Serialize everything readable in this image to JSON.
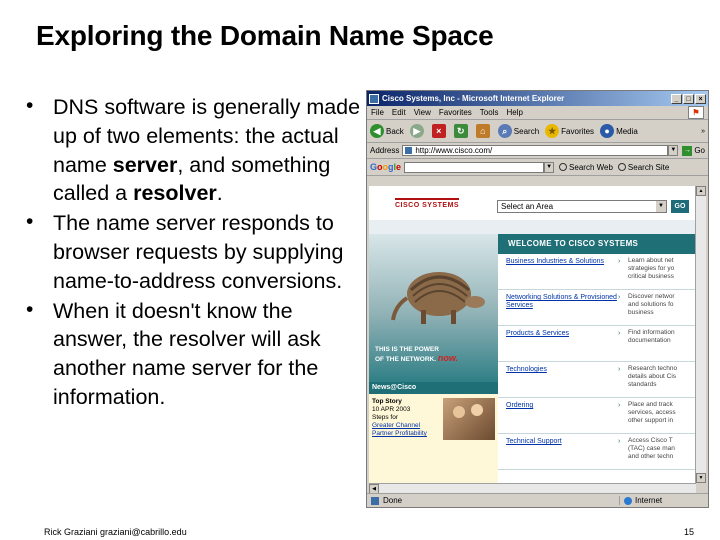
{
  "slide": {
    "title": "Exploring the Domain Name Space",
    "bullets": [
      {
        "pre": "DNS software is generally made up of two elements: the actual name ",
        "bold1": "server",
        "mid": ", and something called a ",
        "bold2": "resolver",
        "post": "."
      },
      {
        "pre": "The name server responds to browser requests by supplying name-to-address conversions.",
        "bold1": "",
        "mid": "",
        "bold2": "",
        "post": ""
      },
      {
        "pre": "When it doesn't know the answer, the resolver will ask another name server for the information.",
        "bold1": "",
        "mid": "",
        "bold2": "",
        "post": ""
      }
    ],
    "bullet_char": "•",
    "footer": "Rick Graziani  graziani@cabrillo.edu",
    "page_number": "15"
  },
  "browser": {
    "window_title": "Cisco Systems, Inc - Microsoft Internet Explorer",
    "menu": [
      "File",
      "Edit",
      "View",
      "Favorites",
      "Tools",
      "Help"
    ],
    "toolbar": {
      "back": "Back",
      "search": "Search",
      "favorites": "Favorites",
      "media": "Media"
    },
    "address_label": "Address",
    "address_value": "http://www.cisco.com/",
    "go_label": "Go",
    "google_search_web": "Search Web",
    "google_search_site": "Search Site",
    "status_left": "Done",
    "status_zone": "Internet"
  },
  "site": {
    "logo": "CISCO SYSTEMS",
    "area_select": "Select an Area",
    "go": "GO",
    "welcome": "WELCOME TO CISCO SYSTEMS",
    "power_line1": "THIS IS THE POWER",
    "power_line2": "OF THE NETWORK.",
    "power_now": "now.",
    "news_tab": "News@Cisco",
    "top_story_title": "Top Story",
    "top_story_date": "10 APR 2003",
    "top_story_l1": "Steps for",
    "top_story_l2": "Greater Channel",
    "top_story_l3": "Partner Profitability",
    "links": [
      {
        "label": "Business Industries & Solutions",
        "desc": "Learn about net\nstrategies for yo\ncritical business"
      },
      {
        "label": "Networking Solutions & Provisioned Services",
        "desc": "Discover networ\nand solutions fo\nbusiness"
      },
      {
        "label": "Products & Services",
        "desc": "Find information\ndocumentation"
      },
      {
        "label": "Technologies",
        "desc": "Research techno\ndetails about Cis\nstandards"
      },
      {
        "label": "Ordering",
        "desc": "Place and track\nservices, access\nother support in"
      },
      {
        "label": "Technical Support",
        "desc": "Access Cisco T\n(TAC) case man\nand other techn"
      }
    ]
  }
}
